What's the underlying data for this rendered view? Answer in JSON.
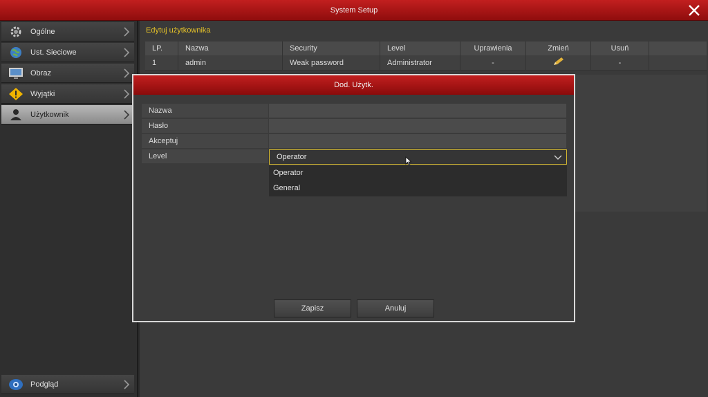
{
  "window": {
    "title": "System Setup"
  },
  "sidebar": {
    "items": [
      {
        "label": "Ogólne",
        "icon": "gear-icon"
      },
      {
        "label": "Ust. Sieciowe",
        "icon": "globe-icon"
      },
      {
        "label": "Obraz",
        "icon": "monitor-icon"
      },
      {
        "label": "Wyjątki",
        "icon": "warning-icon"
      },
      {
        "label": "Użytkownik",
        "icon": "user-icon",
        "active": true
      }
    ],
    "bottom": {
      "label": "Podgląd",
      "icon": "eye-icon"
    }
  },
  "main": {
    "section_title": "Edytuj użytkownika",
    "table": {
      "headers": [
        "LP.",
        "Nazwa",
        "Security",
        "Level",
        "Uprawienia",
        "Zmień",
        "Usuń"
      ],
      "rows": [
        {
          "lp": "1",
          "name": "admin",
          "security": "Weak password",
          "level": "Administrator",
          "permissions": "-",
          "delete": "-"
        }
      ]
    }
  },
  "dialog": {
    "title": "Dod. Użytk.",
    "fields": {
      "name": "Nazwa",
      "password": "Hasło",
      "confirm": "Akceptuj",
      "level": "Level"
    },
    "level_selected": "Operator",
    "level_options": [
      "Operator",
      "General"
    ],
    "save_label": "Zapisz",
    "cancel_label": "Anuluj"
  },
  "colors": {
    "accent_red": "#b51818",
    "highlight_yellow": "#e5c229"
  }
}
